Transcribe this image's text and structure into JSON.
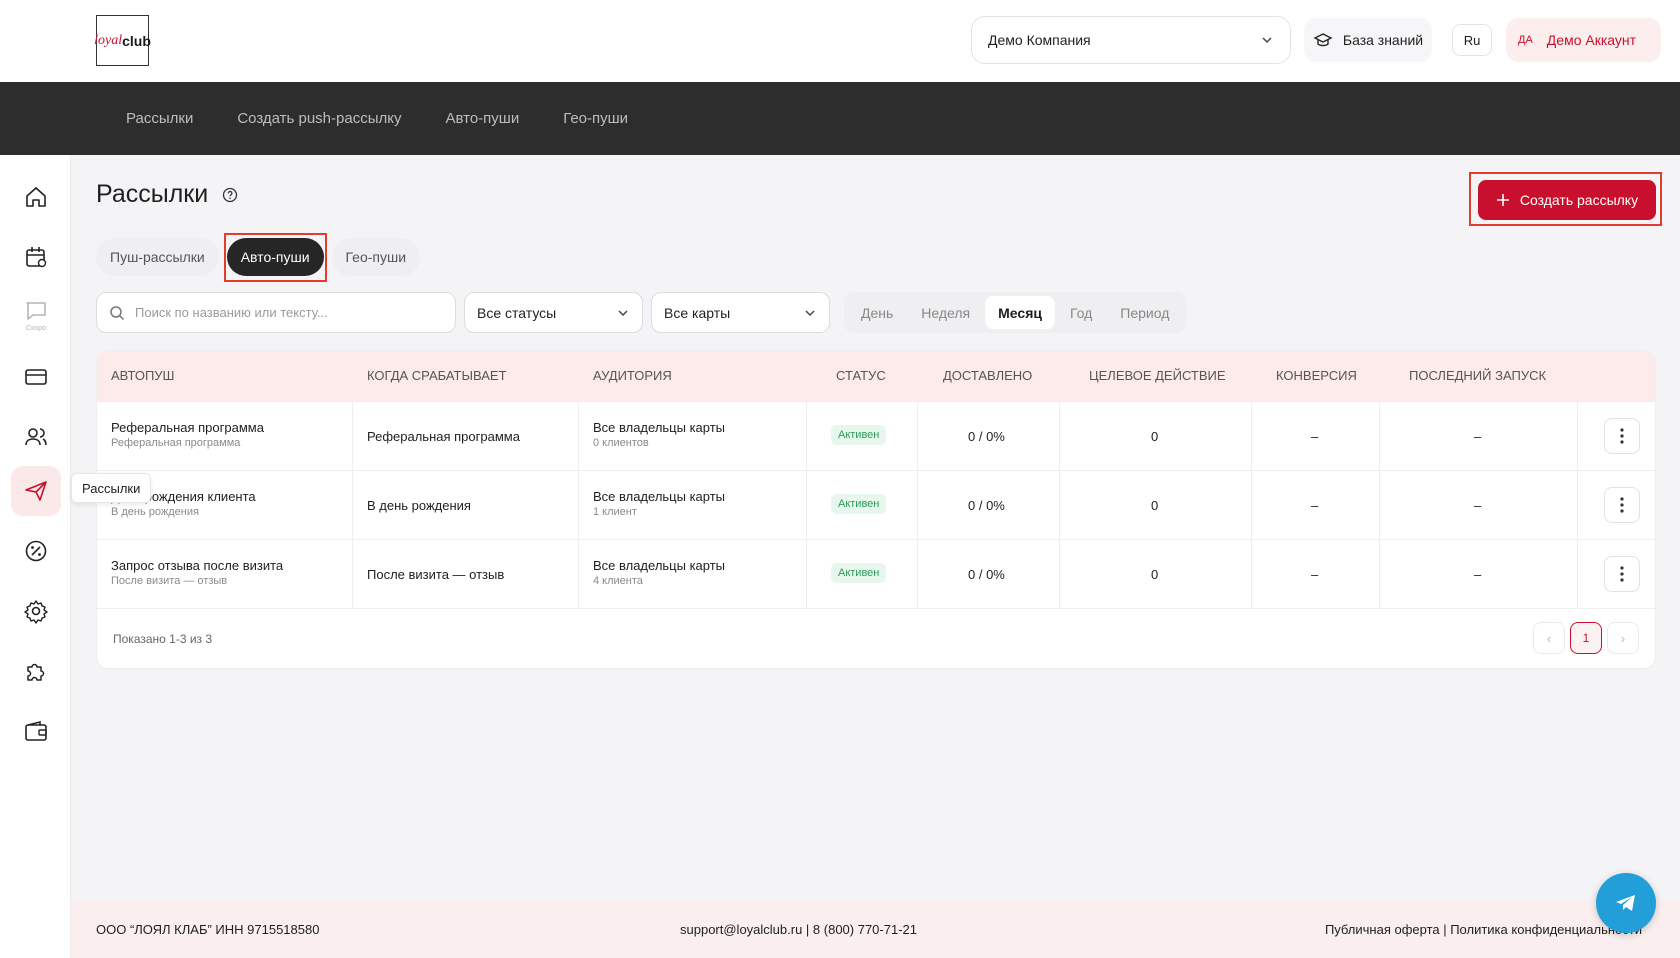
{
  "header": {
    "logo": {
      "loyal": "loyal",
      "club": "club"
    },
    "company": "Демо Компания",
    "knowledge_base": "База знаний",
    "language": "Ru",
    "account_initials": "ДА",
    "account_name": "Демо Аккаунт"
  },
  "topnav": [
    "Рассылки",
    "Создать push-рассылку",
    "Авто-пуши",
    "Гео-пуши"
  ],
  "sidebar": {
    "items": [
      {
        "icon": "home-icon"
      },
      {
        "icon": "calendar-icon"
      },
      {
        "icon": "chat-icon",
        "badge": "Скоро"
      },
      {
        "icon": "card-icon"
      },
      {
        "icon": "users-icon"
      },
      {
        "icon": "send-icon",
        "active": true
      },
      {
        "icon": "percent-icon"
      },
      {
        "icon": "gear-icon"
      },
      {
        "icon": "puzzle-icon"
      },
      {
        "icon": "wallet-icon"
      }
    ],
    "tooltip": "Рассылки"
  },
  "main": {
    "title": "Рассылки",
    "create_button": "Создать рассылку",
    "tabs": [
      {
        "label": "Пуш-рассылки",
        "active": false
      },
      {
        "label": "Авто-пуши",
        "active": true
      },
      {
        "label": "Гео-пуши",
        "active": false
      }
    ],
    "search": {
      "placeholder": "Поиск по названию или тексту..."
    },
    "status_select": "Все статусы",
    "cards_select": "Все карты",
    "periods": [
      {
        "label": "День",
        "active": false
      },
      {
        "label": "Неделя",
        "active": false
      },
      {
        "label": "Месяц",
        "active": true
      },
      {
        "label": "Год",
        "active": false
      },
      {
        "label": "Период",
        "active": false
      }
    ]
  },
  "table": {
    "columns": [
      "Автопуш",
      "Когда срабатывает",
      "Аудитория",
      "Статус",
      "Доставлено",
      "Целевое действие",
      "Конверсия",
      "Последний запуск"
    ],
    "rows": [
      {
        "title": "Реферальная программа",
        "subtitle": "Реферальная программа",
        "trigger": "Реферальная программа",
        "audience": "Все владельцы карты",
        "audience_sub": "0 клиентов",
        "status": "Активен",
        "delivered": "0 / 0%",
        "target": "0",
        "conversion": "–",
        "last_run": "–"
      },
      {
        "title": "День рождения клиента",
        "subtitle": "В день рождения",
        "trigger": "В день рождения",
        "audience": "Все владельцы карты",
        "audience_sub": "1 клиент",
        "status": "Активен",
        "delivered": "0 / 0%",
        "target": "0",
        "conversion": "–",
        "last_run": "–"
      },
      {
        "title": "Запрос отзыва после визита",
        "subtitle": "После визита — отзыв",
        "trigger": "После визита — отзыв",
        "audience": "Все владельцы карты",
        "audience_sub": "4 клиента",
        "status": "Активен",
        "delivered": "0 / 0%",
        "target": "0",
        "conversion": "–",
        "last_run": "–"
      }
    ],
    "shown": "Показано 1-3 из 3",
    "page": "1"
  },
  "footer": {
    "company": "ООО “ЛОЯЛ КЛАБ” ИНН 9715518580",
    "contacts": "support@loyalclub.ru   |   8 (800) 770-71-21",
    "links": "Публичная оферта   |   Политика конфиденциальности"
  },
  "colors": {
    "accent": "#c8102e",
    "dark_nav": "#2d2d2d",
    "highlight_frame": "#e23c2c",
    "status_green": "#2e9a5a"
  }
}
